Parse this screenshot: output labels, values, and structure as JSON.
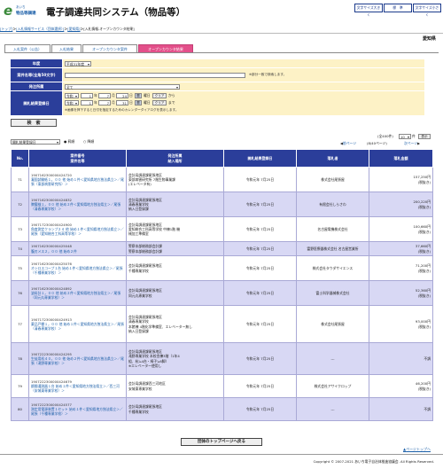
{
  "header": {
    "logo_top": "あいち",
    "logo_bottom": "物品等調達",
    "title": "電子調達共同システム（物品等）",
    "font_large": "文字サイズ大きく",
    "font_std": "標　準",
    "font_small": "文字サイズ小さく"
  },
  "breadcrumb": {
    "a": "[トップ]",
    "sep1": "＞",
    "b": "[入札情報サービス（団体選択）]",
    "sep2": "＞",
    "c": "[愛知県]",
    "sep3": "＞",
    "d": "[入札情報-オープンカウンタ結果]"
  },
  "pref": "愛知県",
  "tabs": [
    "入札案件（公告）",
    "入札結果",
    "オープンカウンタ案件",
    "オープンカウンタ結果"
  ],
  "form": {
    "year_label": "年度",
    "year_value": "平成31年度",
    "name_label": "案件名等",
    "name_label2": "(全角50文字)",
    "name_note": "※部分一致で検索します。",
    "org_label": "発注所属",
    "org_value": "全て",
    "date_label": "開札結果登録日",
    "era1": "令和",
    "y1": "1",
    "m1": "7",
    "d1": "24",
    "era2": "令和",
    "y2": "1",
    "m2": "7",
    "d2": "31",
    "year_u": "年",
    "month_u": "月",
    "day_u": "日",
    "cal": "暦",
    "weekday_u": "曜日",
    "clear": "クリア",
    "from": "から",
    "to": "まで",
    "cal_note": "※画像を押下すると日付を指定するためのカレンダーダイアログを表示します。",
    "search": "検　索"
  },
  "sortbar": {
    "sort_select": "開札結果登録日",
    "asc": "昇順",
    "desc": "降順",
    "count": "(全400件)",
    "per_page": "10",
    "per_unit": "件",
    "display": "表示",
    "prev": "前ページ",
    "pageinfo": "(8/40ページ)",
    "next": "次ページ"
  },
  "table": {
    "headers": {
      "no": "No.",
      "case": "案件番号\n案件名等",
      "org": "発注所属\n納入場所",
      "date": "開札結果登録日",
      "winner": "落札者",
      "amount": "落札金額"
    },
    "rows": [
      {
        "no": "71",
        "num": "1907162300000424720",
        "name": "凝固試験紙１，００ 他 始め１件＜愛知県地方独法県立＞／尾張（東部病害研究所）＞",
        "org1": "会計局調達課尾張地区",
        "org2": "東部病害研究所 7階生物事業課",
        "org3": "(エレベータ有)",
        "date": "令和元年 7月25日",
        "winner": "株式会社尾張屋",
        "amount": "157,250円",
        "tax": "(税抜き)"
      },
      {
        "no": "72",
        "num": "1907162300000424832",
        "name": "脾臓検１，００ 他 始め２件＜愛知県地方独法県立＞／尾張（清春専業学校）＞",
        "org1": "会計局調達課尾張地区",
        "org2": "清春専業学校",
        "org3": "納入日登録課",
        "date": "令和元年 7月25日",
        "winner": "有限会社しらさわ",
        "amount": "200,220円",
        "tax": "(税抜き)"
      },
      {
        "no": "73",
        "num": "1907172300000424900",
        "name": "角度測定クランプ２４ 他 始め１件＜愛知県地方独法県立＞／尾張（愛知総合工科高等学校）＞",
        "org1": "会計局調達課尾張地区",
        "org2": "愛知総合工科高等学校 中棟1階 機",
        "org3": "械加工準備室",
        "date": "令和元年 7月25日",
        "winner": "名古屋電機株式会社",
        "amount": "100,660円",
        "tax": "(税抜き)"
      },
      {
        "no": "74",
        "num": "1907162300000425048",
        "name": "腹刃メス２，００ 他 始め２件",
        "org1": "警察本部総務部会計課",
        "org2": "警察本部総務部会計課",
        "org3": "",
        "date": "令和元年 7月25日",
        "winner": "富野医療器株式会社 名古屋営業所",
        "amount": "37,660円",
        "tax": "(税抜き)"
      },
      {
        "no": "75",
        "num": "1907162300000425076",
        "name": "オシロスコープ１台 始め１件＜愛知県地方独法県立＞／尾張（千種専業学校）＞",
        "org1": "会計局調達課尾張地区",
        "org2": "千種専業学校",
        "org3": "",
        "date": "令和元年 7月25日",
        "winner": "株式会社タウダサイエンス",
        "amount": "71,200円",
        "tax": "(税抜き)"
      },
      {
        "no": "76",
        "num": "1907162300000424892",
        "name": "塗料計１，００ 他 始め２件＜愛知県地方独法県立＞／尾張（同元丸専業学校）＞",
        "org1": "会計局調達課尾張地区",
        "org2": "同元丸専業学校",
        "org3": "",
        "date": "令和元年 7月25日",
        "winner": "富士科学器械株式会社",
        "amount": "52,360円",
        "tax": "(税抜き)"
      },
      {
        "no": "77",
        "num": "1907172300000424913",
        "name": "薬品戸棚１，００ 他 始め１件＜愛知県地方独法県立＞／尾張（清春専業学校）＞",
        "org1": "会計局調達課尾張地区",
        "org2": "清春専業学校",
        "org3": "本館棟 4階化学準備室、エレベーター無し",
        "org4": "納入日登録課",
        "date": "令和元年 7月25日",
        "winner": "株式会社尾張屋",
        "amount": "93,000円",
        "tax": "(税抜き)"
      },
      {
        "no": "78",
        "num": "1907222300000424295",
        "name": "生徒用机４０，００ 他 始め２件＜愛知県地方独法県立＞／尾張（滝野専業学校）＞",
        "org1": "会計局調達課尾張地区",
        "org2": "滝野専業学校 本校舎棟3階（1年4",
        "org3": "組、杭≒4台・椅子≒6脚）",
        "org4": "※エレベーター使用し",
        "date": "令和元年 7月25日",
        "winner": "---",
        "amount": "不調",
        "tax": ""
      },
      {
        "no": "79",
        "num": "1907222300000424679",
        "name": "鋼間通測器１台 始め１件＜愛知県地方独法県立＞／西三河（安城東専業学校）＞",
        "org1": "会計局調達課西三河地区",
        "org2": "安城東専業学校",
        "org3": "",
        "date": "令和元年 7月25日",
        "winner": "株式会社アサイクロップ",
        "amount": "46,200円",
        "tax": "(税抜き)"
      },
      {
        "no": "80",
        "num": "1907222300000424577",
        "name": "測定用電源装置１セット 始め１件＜愛知県地方独法県立＞／尾張（千種専業学校）＞",
        "org1": "会計局調達課尾張地区",
        "org2": "千種専業学校",
        "org3": "",
        "date": "令和元年 7月25日",
        "winner": "---",
        "amount": "不調",
        "tax": ""
      }
    ]
  },
  "bottom_button": "団体のトップページへ戻る",
  "page_top": "ページトップへ",
  "footer": "Copyright © 2007-2021 あいち電子自治体推進協議会. All Rights Reserved."
}
